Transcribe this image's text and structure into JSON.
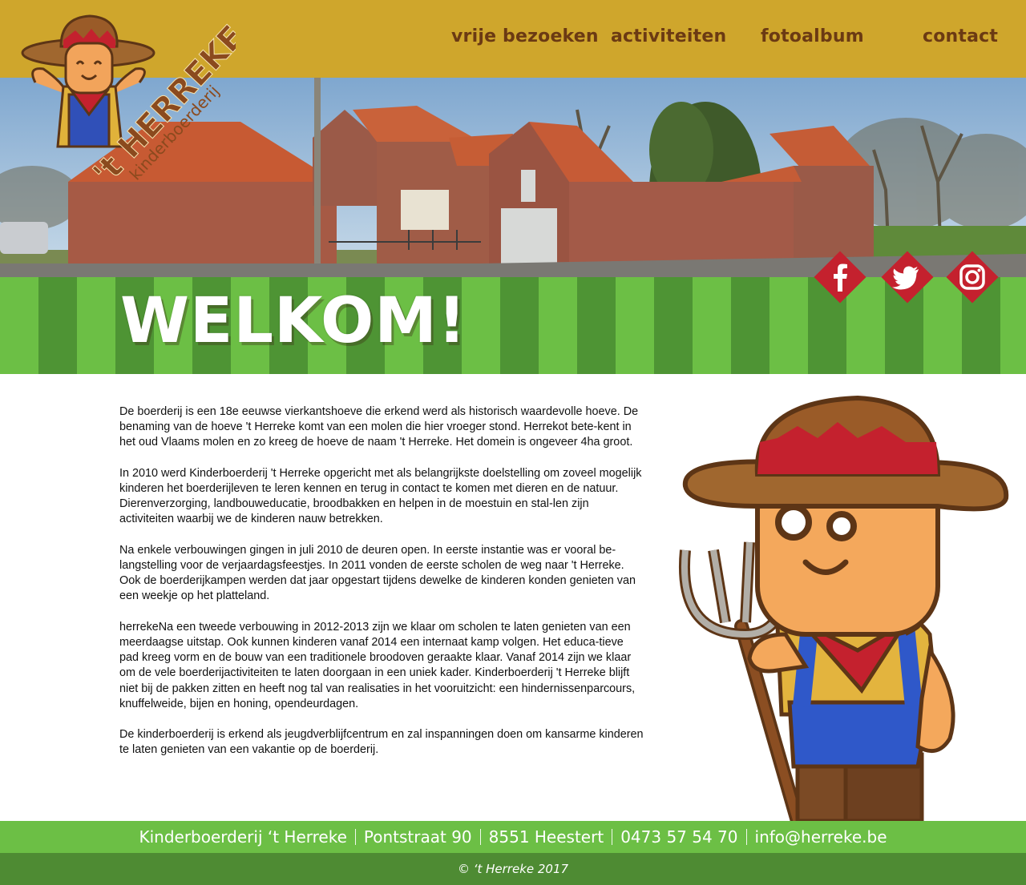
{
  "nav": {
    "items": [
      {
        "label": "vrije bezoeken"
      },
      {
        "label": "activiteiten"
      },
      {
        "label": "fotoalbum"
      },
      {
        "label": "contact"
      }
    ]
  },
  "logo": {
    "name": "'t HERREKE",
    "tagline": "kinderboerderij"
  },
  "hero": {
    "heading": "WELKOM!"
  },
  "social": [
    {
      "icon": "facebook-icon"
    },
    {
      "icon": "twitter-icon"
    },
    {
      "icon": "instagram-icon"
    }
  ],
  "content": {
    "paragraphs": [
      "De boerderij is een 18e eeuwse vierkantshoeve die erkend werd als historisch waardevolle hoeve. De benaming van de hoeve 't Herreke komt van een molen die hier vroeger stond. Herrekot bete-kent in het oud Vlaams molen en zo kreeg de hoeve de naam 't Herreke. Het domein is ongeveer 4ha groot.",
      "In 2010 werd Kinderboerderij 't Herreke opgericht met als belangrijkste doelstelling om zoveel mogelijk kinderen het boerderijleven te leren kennen en terug in contact te komen met dieren en de natuur. Dierenverzorging, landbouweducatie, broodbakken en helpen in de moestuin en stal-len zijn activiteiten waarbij we de kinderen nauw betrekken.",
      "Na enkele verbouwingen gingen in juli 2010 de deuren open. In eerste instantie was er vooral be-langstelling voor de verjaardagsfeestjes. In 2011 vonden de eerste scholen de weg naar 't Herreke. Ook de boerderijkampen werden dat jaar opgestart tijdens dewelke de kinderen konden genieten van een weekje op het platteland.",
      "herrekeNa een tweede verbouwing in 2012-2013 zijn we klaar om scholen te laten genieten van een meerdaagse uitstap. Ook kunnen kinderen vanaf 2014 een internaat kamp volgen. Het educa-tieve pad kreeg vorm en de bouw van een traditionele broodoven geraakte klaar. Vanaf 2014 zijn we klaar om de vele boerderijactiviteiten te laten doorgaan in een uniek kader. Kinderboerderij 't Herreke blijft niet bij de pakken zitten en heeft nog tal van realisaties in het vooruitzicht: een hindernissenparcours, knuffelweide, bijen en honing, opendeurdagen.",
      "De kinderboerderij is erkend als jeugdverblijfcentrum en zal inspanningen doen om kansarme kinderen te laten genieten van een vakantie op de boerderij."
    ]
  },
  "footer": {
    "name": "Kinderboerderij ‘t Herreke",
    "street": "Pontstraat 90",
    "city": "8551 Heestert",
    "phone": "0473 57 54 70",
    "email": "info@herreke.be",
    "copyright": "© ‘t Herreke 2017"
  },
  "colors": {
    "header": "#cfa62c",
    "nav_text": "#6b3a13",
    "stripe_light": "#6cbf45",
    "stripe_dark": "#4e9434",
    "social_red": "#c4212e",
    "footer_top": "#6cbf45",
    "footer_bottom": "#4e8b33"
  }
}
